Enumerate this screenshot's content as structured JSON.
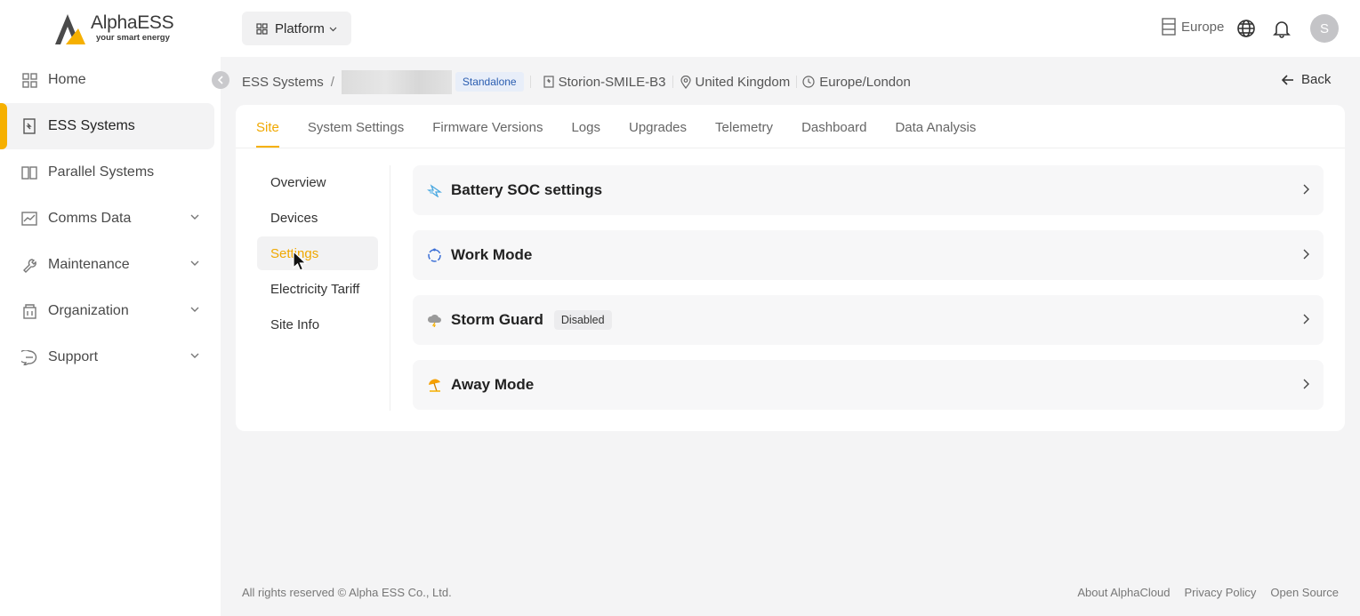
{
  "brand": {
    "name": "AlphaESS",
    "tagline": "your smart energy"
  },
  "sidebar": {
    "items": [
      {
        "label": "Home",
        "icon": "home-grid-icon"
      },
      {
        "label": "ESS Systems",
        "icon": "ess-device-icon",
        "active": true
      },
      {
        "label": "Parallel Systems",
        "icon": "parallel-icon"
      },
      {
        "label": "Comms Data",
        "icon": "chart-icon",
        "expandable": true
      },
      {
        "label": "Maintenance",
        "icon": "wrench-icon",
        "expandable": true
      },
      {
        "label": "Organization",
        "icon": "building-icon",
        "expandable": true
      },
      {
        "label": "Support",
        "icon": "chat-icon",
        "expandable": true
      }
    ]
  },
  "topbar": {
    "platform_label": "Platform",
    "region_label": "Europe",
    "avatar_initial": "S"
  },
  "breadcrumb": {
    "root": "ESS Systems",
    "separator": "/",
    "mode_badge": "Standalone",
    "model": "Storion-SMILE-B3",
    "country": "United Kingdom",
    "timezone": "Europe/London",
    "back_label": "Back"
  },
  "tabs": [
    "Site",
    "System Settings",
    "Firmware Versions",
    "Logs",
    "Upgrades",
    "Telemetry",
    "Dashboard",
    "Data Analysis"
  ],
  "active_tab": "Site",
  "submenu": [
    "Overview",
    "Devices",
    "Settings",
    "Electricity Tariff",
    "Site Info"
  ],
  "active_submenu": "Settings",
  "panels": [
    {
      "title": "Battery SOC settings",
      "icon": "battery-soc-icon"
    },
    {
      "title": "Work Mode",
      "icon": "work-mode-icon"
    },
    {
      "title": "Storm Guard",
      "icon": "storm-cloud-icon",
      "badge": "Disabled"
    },
    {
      "title": "Away Mode",
      "icon": "beach-umbrella-icon"
    }
  ],
  "footer": {
    "copyright": "All rights reserved © Alpha ESS Co., Ltd.",
    "links": [
      "About AlphaCloud",
      "Privacy Policy",
      "Open Source"
    ]
  },
  "colors": {
    "accent": "#f6b000",
    "badge_blue": "#2a5db0"
  }
}
